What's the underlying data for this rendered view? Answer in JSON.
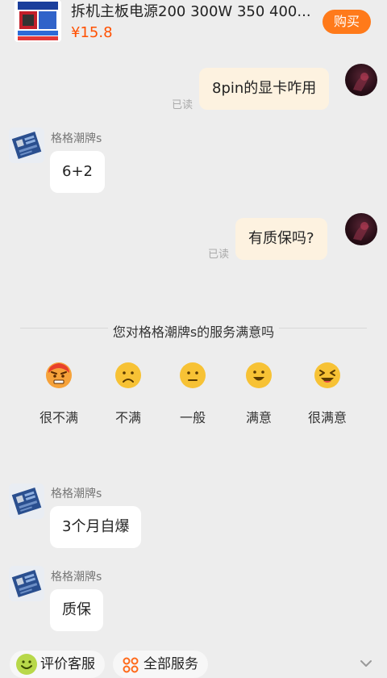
{
  "product": {
    "title": "拆机主板电源200 300W 350 400...",
    "price": "¥15.8",
    "buy_label": "购买"
  },
  "messages": [
    {
      "side": "right",
      "text": "8pin的显卡咋用",
      "status": "已读"
    },
    {
      "side": "left",
      "sender": "格格潮牌s",
      "text": "6+2"
    },
    {
      "side": "right",
      "text": "有质保吗?",
      "status": "已读"
    },
    {
      "side": "left",
      "sender": "格格潮牌s",
      "text": "3个月自爆"
    },
    {
      "side": "left",
      "sender": "格格潮牌s",
      "text": "质保"
    }
  ],
  "survey": {
    "title": "您对格格潮牌s的服务满意吗",
    "options": [
      {
        "label": "很不满",
        "icon": "angry-face-icon"
      },
      {
        "label": "不满",
        "icon": "frown-face-icon"
      },
      {
        "label": "一般",
        "icon": "neutral-face-icon"
      },
      {
        "label": "满意",
        "icon": "smile-face-icon"
      },
      {
        "label": "很满意",
        "icon": "laughing-face-icon"
      }
    ]
  },
  "bottom_bar": {
    "review_label": "评价客服",
    "services_label": "全部服务"
  },
  "colors": {
    "accent": "#ff7a1a",
    "price": "#ff5000",
    "bubble_right": "#fdf2e0",
    "background": "#ededed"
  }
}
